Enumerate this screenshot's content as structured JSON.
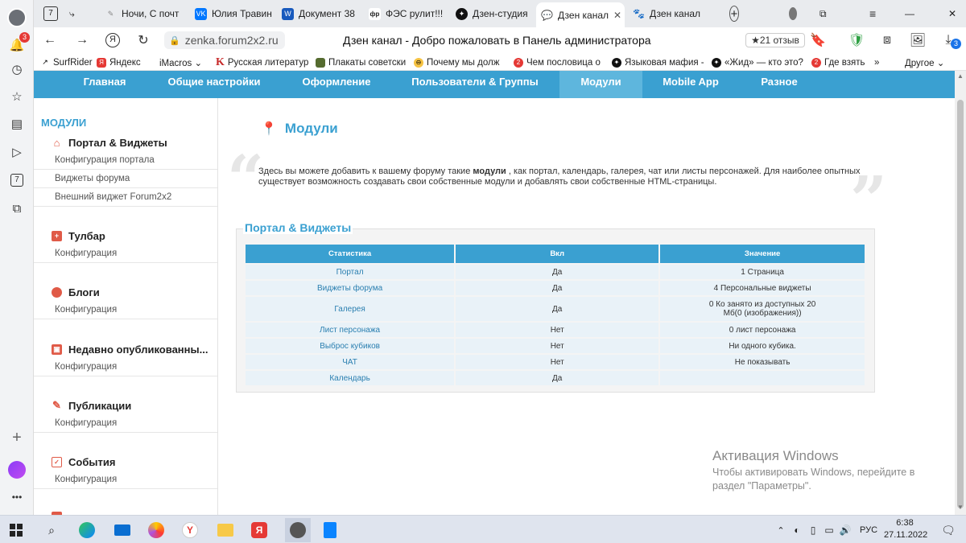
{
  "rail": {
    "badge_count": "3",
    "items": [
      "bell-icon",
      "history-icon",
      "star-icon",
      "collections-icon",
      "video-icon",
      "calendar-icon",
      "screenshot-icon"
    ]
  },
  "tabs": [
    {
      "label": "Ночи, С почт"
    },
    {
      "label": "Юлия Травин",
      "icon_text": "VK"
    },
    {
      "label": "Документ 38",
      "icon_text": "W"
    },
    {
      "label": "ФЭС рулит!!!",
      "icon_text": "фр"
    },
    {
      "label": "Дзен-студия"
    },
    {
      "label": "Дзен канал",
      "active": true
    },
    {
      "label": "Дзен канал"
    }
  ],
  "address": {
    "url": "zenka.forum2x2.ru",
    "page_title": "Дзен канал - Добро пожаловать в Панель администратора",
    "reviews": "★21 отзыв",
    "downloads_badge": "3",
    "tabs_counter": "7"
  },
  "bookmarks": [
    {
      "label": "SurfRider"
    },
    {
      "label": "Яндекс"
    },
    {
      "label": "iMacros ⌄"
    },
    {
      "label": "Русская литератур"
    },
    {
      "label": "Плакаты советски"
    },
    {
      "label": "Почему мы долж"
    },
    {
      "label": "Чем пословица о"
    },
    {
      "label": "Языковая мафия -"
    },
    {
      "label": "«Жид» — кто это?"
    },
    {
      "label": "Где взять"
    },
    {
      "label": "»"
    },
    {
      "label": "Другое ⌄"
    }
  ],
  "admin_nav": [
    {
      "label": "Главная"
    },
    {
      "label": "Общие настройки"
    },
    {
      "label": "Оформление"
    },
    {
      "label": "Пользователи & Группы"
    },
    {
      "label": "Модули",
      "active": true
    },
    {
      "label": "Mobile App"
    },
    {
      "label": "Разное"
    }
  ],
  "sidebar": {
    "title": "МОДУЛИ",
    "sections": [
      {
        "title": "Портал & Виджеты",
        "items": [
          "Конфигурация портала",
          "Виджеты форума",
          "Внешний виджет Forum2x2"
        ]
      },
      {
        "title": "Тулбар",
        "items": [
          "Конфигурация"
        ]
      },
      {
        "title": "Блоги",
        "items": [
          "Конфигурация"
        ]
      },
      {
        "title": "Недавно опубликованны...",
        "items": [
          "Конфигурация"
        ]
      },
      {
        "title": "Публикации",
        "items": [
          "Конфигурация"
        ]
      },
      {
        "title": "События",
        "items": [
          "Конфигурация"
        ]
      }
    ]
  },
  "main": {
    "title": "Модули",
    "intro_line1_pre": "Здесь вы можете добавить к вашему форуму такие ",
    "intro_line1_bold": "модули",
    "intro_line1_post": " , как портал, календарь, галерея, чат или листы персонажей. Для наиболее опытных",
    "intro_line2": "существует возможность создавать свои собственные модули и добавлять свои собственные HTML-страницы.",
    "panel_title": "Портал & Виджеты",
    "table": {
      "headers": [
        "Статистика",
        "Вкл",
        "Значение"
      ],
      "rows": [
        [
          "Портал",
          "Да",
          "1 Страница"
        ],
        [
          "Виджеты форума",
          "Да",
          "4 Персональные виджеты"
        ],
        [
          "Галерея",
          "Да",
          "0 Ко занято из доступных 20 Мб(0 (изображения))"
        ],
        [
          "Лист персонажа",
          "Нет",
          "0 лист персонажа"
        ],
        [
          "Выброс кубиков",
          "Нет",
          "Ни одного кубика."
        ],
        [
          "ЧАТ",
          "Нет",
          "Не показывать"
        ],
        [
          "Календарь",
          "Да",
          ""
        ]
      ]
    }
  },
  "activation": {
    "title": "Активация Windows",
    "line1": "Чтобы активировать Windows, перейдите в",
    "line2": "раздел \"Параметры\"."
  },
  "taskbar": {
    "lang": "РУС",
    "time": "6:38",
    "date": "27.11.2022"
  },
  "colors": {
    "accent": "#3aa0d1",
    "nav_active": "#5eb6dd"
  }
}
